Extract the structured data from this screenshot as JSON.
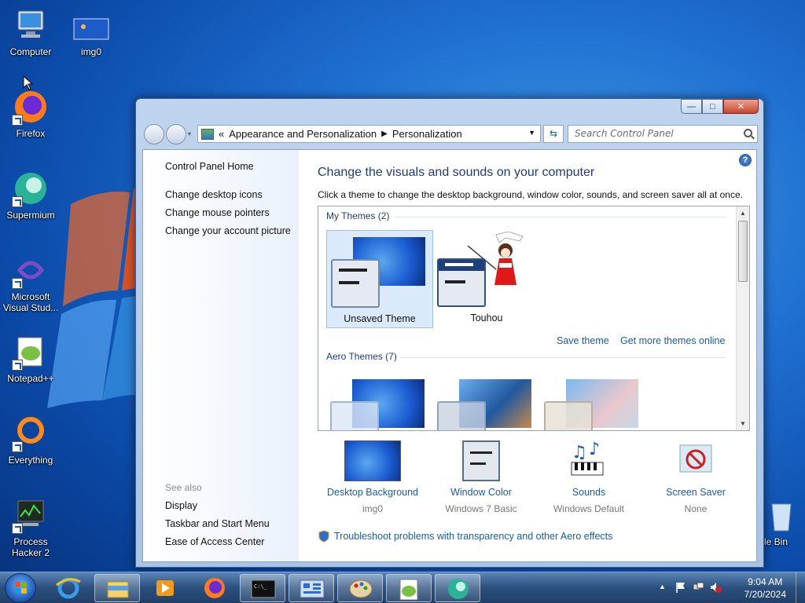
{
  "desktop": {
    "icons": [
      {
        "label": "Computer"
      },
      {
        "label": "img0"
      },
      {
        "label": "Firefox"
      },
      {
        "label": "Supermium"
      },
      {
        "label": "Microsoft Visual Stud..."
      },
      {
        "label": "Notepad++"
      },
      {
        "label": "Everything"
      },
      {
        "label": "Process Hacker 2"
      },
      {
        "label": "cle Bin"
      }
    ]
  },
  "window": {
    "breadcrumb": {
      "overflow": "«",
      "items": [
        "Appearance and Personalization",
        "Personalization"
      ]
    },
    "search_placeholder": "Search Control Panel",
    "left_pane": {
      "home": "Control Panel Home",
      "links": [
        "Change desktop icons",
        "Change mouse pointers",
        "Change your account picture"
      ],
      "see_also_label": "See also",
      "see_also": [
        "Display",
        "Taskbar and Start Menu",
        "Ease of Access Center"
      ]
    },
    "title": "Change the visuals and sounds on your computer",
    "subtitle": "Click a theme to change the desktop background, window color, sounds, and screen saver all at once.",
    "my_themes_label": "My Themes (2)",
    "my_themes": [
      {
        "name": "Unsaved Theme",
        "selected": true
      },
      {
        "name": "Touhou",
        "selected": false
      }
    ],
    "save_theme": "Save theme",
    "get_more": "Get more themes online",
    "aero_themes_label": "Aero Themes (7)",
    "bottom": [
      {
        "title": "Desktop Background",
        "value": "img0"
      },
      {
        "title": "Window Color",
        "value": "Windows 7 Basic"
      },
      {
        "title": "Sounds",
        "value": "Windows Default"
      },
      {
        "title": "Screen Saver",
        "value": "None"
      }
    ],
    "troubleshoot": "Troubleshoot problems with transparency and other Aero effects"
  },
  "taskbar": {
    "time": "9:04 AM",
    "date": "7/20/2024"
  }
}
